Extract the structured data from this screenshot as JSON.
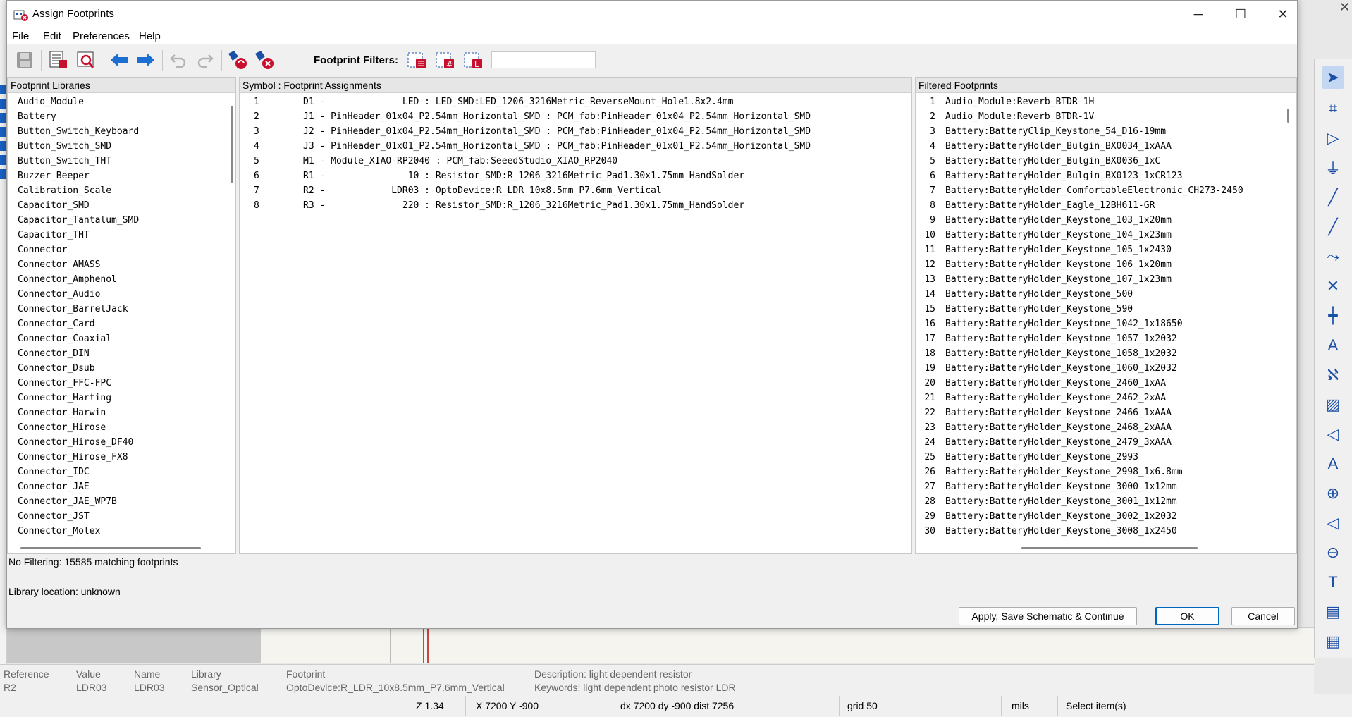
{
  "dialog": {
    "title": "Assign Footprints",
    "menu": [
      "File",
      "Edit",
      "Preferences",
      "Help"
    ],
    "filters_label": "Footprint Filters:",
    "filter_input_value": "",
    "libraries_header": "Footprint Libraries",
    "assignments_header": "Symbol : Footprint Assignments",
    "filtered_header": "Filtered Footprints",
    "libraries": [
      "Audio_Module",
      "Battery",
      "Button_Switch_Keyboard",
      "Button_Switch_SMD",
      "Button_Switch_THT",
      "Buzzer_Beeper",
      "Calibration_Scale",
      "Capacitor_SMD",
      "Capacitor_Tantalum_SMD",
      "Capacitor_THT",
      "Connector",
      "Connector_AMASS",
      "Connector_Amphenol",
      "Connector_Audio",
      "Connector_BarrelJack",
      "Connector_Card",
      "Connector_Coaxial",
      "Connector_DIN",
      "Connector_Dsub",
      "Connector_FFC-FPC",
      "Connector_Harting",
      "Connector_Harwin",
      "Connector_Hirose",
      "Connector_Hirose_DF40",
      "Connector_Hirose_FX8",
      "Connector_IDC",
      "Connector_JAE",
      "Connector_JAE_WP7B",
      "Connector_JST",
      "Connector_Molex"
    ],
    "assignments": [
      {
        "num": "1",
        "text": "D1 -              LED : LED_SMD:LED_1206_3216Metric_ReverseMount_Hole1.8x2.4mm"
      },
      {
        "num": "2",
        "text": "J1 - PinHeader_01x04_P2.54mm_Horizontal_SMD : PCM_fab:PinHeader_01x04_P2.54mm_Horizontal_SMD"
      },
      {
        "num": "3",
        "text": "J2 - PinHeader_01x04_P2.54mm_Horizontal_SMD : PCM_fab:PinHeader_01x04_P2.54mm_Horizontal_SMD"
      },
      {
        "num": "4",
        "text": "J3 - PinHeader_01x01_P2.54mm_Horizontal_SMD : PCM_fab:PinHeader_01x01_P2.54mm_Horizontal_SMD"
      },
      {
        "num": "5",
        "text": "M1 - Module_XIAO-RP2040 : PCM_fab:SeeedStudio_XIAO_RP2040"
      },
      {
        "num": "6",
        "text": "R1 -               10 : Resistor_SMD:R_1206_3216Metric_Pad1.30x1.75mm_HandSolder"
      },
      {
        "num": "7",
        "text": "R2 -            LDR03 : OptoDevice:R_LDR_10x8.5mm_P7.6mm_Vertical"
      },
      {
        "num": "8",
        "text": "R3 -              220 : Resistor_SMD:R_1206_3216Metric_Pad1.30x1.75mm_HandSolder"
      }
    ],
    "filtered": [
      {
        "num": "1",
        "text": "Audio_Module:Reverb_BTDR-1H"
      },
      {
        "num": "2",
        "text": "Audio_Module:Reverb_BTDR-1V"
      },
      {
        "num": "3",
        "text": "Battery:BatteryClip_Keystone_54_D16-19mm"
      },
      {
        "num": "4",
        "text": "Battery:BatteryHolder_Bulgin_BX0034_1xAAA"
      },
      {
        "num": "5",
        "text": "Battery:BatteryHolder_Bulgin_BX0036_1xC"
      },
      {
        "num": "6",
        "text": "Battery:BatteryHolder_Bulgin_BX0123_1xCR123"
      },
      {
        "num": "7",
        "text": "Battery:BatteryHolder_ComfortableElectronic_CH273-2450"
      },
      {
        "num": "8",
        "text": "Battery:BatteryHolder_Eagle_12BH611-GR"
      },
      {
        "num": "9",
        "text": "Battery:BatteryHolder_Keystone_103_1x20mm"
      },
      {
        "num": "10",
        "text": "Battery:BatteryHolder_Keystone_104_1x23mm"
      },
      {
        "num": "11",
        "text": "Battery:BatteryHolder_Keystone_105_1x2430"
      },
      {
        "num": "12",
        "text": "Battery:BatteryHolder_Keystone_106_1x20mm"
      },
      {
        "num": "13",
        "text": "Battery:BatteryHolder_Keystone_107_1x23mm"
      },
      {
        "num": "14",
        "text": "Battery:BatteryHolder_Keystone_500"
      },
      {
        "num": "15",
        "text": "Battery:BatteryHolder_Keystone_590"
      },
      {
        "num": "16",
        "text": "Battery:BatteryHolder_Keystone_1042_1x18650"
      },
      {
        "num": "17",
        "text": "Battery:BatteryHolder_Keystone_1057_1x2032"
      },
      {
        "num": "18",
        "text": "Battery:BatteryHolder_Keystone_1058_1x2032"
      },
      {
        "num": "19",
        "text": "Battery:BatteryHolder_Keystone_1060_1x2032"
      },
      {
        "num": "20",
        "text": "Battery:BatteryHolder_Keystone_2460_1xAA"
      },
      {
        "num": "21",
        "text": "Battery:BatteryHolder_Keystone_2462_2xAA"
      },
      {
        "num": "22",
        "text": "Battery:BatteryHolder_Keystone_2466_1xAAA"
      },
      {
        "num": "23",
        "text": "Battery:BatteryHolder_Keystone_2468_2xAAA"
      },
      {
        "num": "24",
        "text": "Battery:BatteryHolder_Keystone_2479_3xAAA"
      },
      {
        "num": "25",
        "text": "Battery:BatteryHolder_Keystone_2993"
      },
      {
        "num": "26",
        "text": "Battery:BatteryHolder_Keystone_2998_1x6.8mm"
      },
      {
        "num": "27",
        "text": "Battery:BatteryHolder_Keystone_3000_1x12mm"
      },
      {
        "num": "28",
        "text": "Battery:BatteryHolder_Keystone_3001_1x12mm"
      },
      {
        "num": "29",
        "text": "Battery:BatteryHolder_Keystone_3002_1x2032"
      },
      {
        "num": "30",
        "text": "Battery:BatteryHolder_Keystone_3008_1x2450"
      }
    ],
    "filter_status": "No Filtering: 15585 matching footprints",
    "library_location": "Library location: unknown",
    "buttons": {
      "apply": "Apply, Save Schematic & Continue",
      "ok": "OK",
      "cancel": "Cancel"
    }
  },
  "status_info": {
    "reference_label": "Reference",
    "reference_value": "R2",
    "value_label": "Value",
    "value_value": "LDR03",
    "name_label": "Name",
    "name_value": "LDR03",
    "library_label": "Library",
    "library_value": "Sensor_Optical",
    "footprint_label": "Footprint",
    "footprint_value": "OptoDevice:R_LDR_10x8.5mm_P7.6mm_Vertical",
    "description": "Description: light dependent resistor",
    "keywords": "Keywords: light dependent photo resistor LDR"
  },
  "status_bar": {
    "zoom": "Z 1.34",
    "cursor": "X 7200  Y -900",
    "delta": "dx 7200  dy -900  dist 7256",
    "grid": "grid 50",
    "units": "mils",
    "mode": "Select item(s)"
  },
  "colors": {
    "accent": "#1c4fa6",
    "ok_border": "#0067c0",
    "toolbar_icon_red": "#c8102e"
  }
}
